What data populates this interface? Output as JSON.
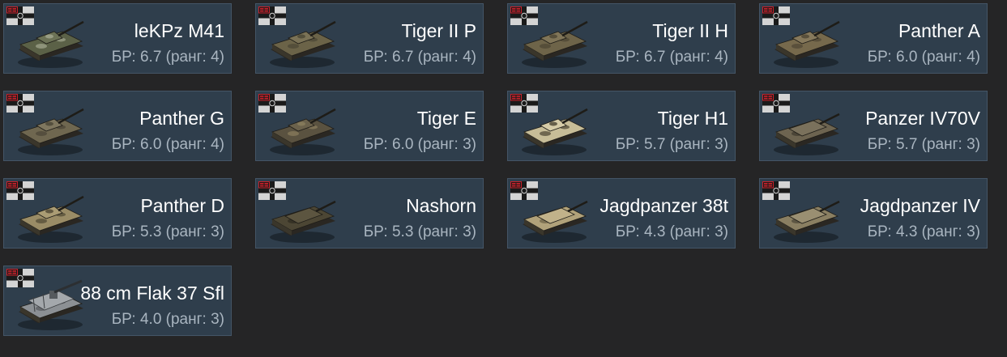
{
  "nation": "germany",
  "flag_icon": "german-war-ensign-icon",
  "vehicles": [
    {
      "name": "leKPz M41",
      "br": "БР: 6.7 (ранг: 4)",
      "icon": "tank-icon",
      "hull": "#5b6147",
      "turret": "#6c7256",
      "camo": "#a4a890"
    },
    {
      "name": "Tiger II P",
      "br": "БР: 6.7 (ранг: 4)",
      "icon": "tank-icon",
      "hull": "#6b6348",
      "turret": "#7a7256",
      "camo": "#4a4634"
    },
    {
      "name": "Tiger II H",
      "br": "БР: 6.7 (ранг: 4)",
      "icon": "tank-icon",
      "hull": "#6e6449",
      "turret": "#807558",
      "camo": "#4b4533"
    },
    {
      "name": "Panther A",
      "br": "БР: 6.0 (ранг: 4)",
      "icon": "tank-icon",
      "hull": "#76694c",
      "turret": "#86795c",
      "camo": "#4e4634"
    },
    {
      "name": "Panther G",
      "br": "БР: 6.0 (ранг: 4)",
      "icon": "tank-icon",
      "hull": "#6f6750",
      "turret": "#7f775f",
      "camo": "#4a4536"
    },
    {
      "name": "Tiger E",
      "br": "БР: 6.0 (ранг: 3)",
      "icon": "tank-icon",
      "hull": "#5a5240",
      "turret": "#6b624c",
      "camo": "#8b7f5e"
    },
    {
      "name": "Tiger H1",
      "br": "БР: 5.7 (ранг: 3)",
      "icon": "tank-icon",
      "hull": "#c7bd98",
      "turret": "#d6cca8",
      "camo": "#4a4332"
    },
    {
      "name": "Panzer IV70V",
      "br": "БР: 5.7 (ранг: 3)",
      "icon": "tank-destroyer-icon",
      "hull": "#6d6450",
      "turret": "#7a715c",
      "camo": "#3d382c"
    },
    {
      "name": "Panther D",
      "br": "БР: 5.3 (ранг: 3)",
      "icon": "tank-icon",
      "hull": "#9a8c66",
      "turret": "#aa9c74",
      "camo": "#4f4733"
    },
    {
      "name": "Nashorn",
      "br": "БР: 5.3 (ранг: 3)",
      "icon": "tank-destroyer-icon",
      "hull": "#4c4634",
      "turret": "#5c5540",
      "camo": "#2e2a20"
    },
    {
      "name": "Jagdpanzer 38t",
      "br": "БР: 4.3 (ранг: 3)",
      "icon": "tank-destroyer-icon",
      "hull": "#b1a27a",
      "turret": "#c1b28a",
      "camo": "#6a5f45"
    },
    {
      "name": "Jagdpanzer IV",
      "br": "БР: 4.3 (ранг: 3)",
      "icon": "tank-destroyer-icon",
      "hull": "#8a7f62",
      "turret": "#9a8f72",
      "camo": "#4a4536"
    },
    {
      "name": "88 cm Flak 37 Sfl",
      "br": "БР: 4.0 (ранг: 3)",
      "icon": "flak-vehicle-icon",
      "hull": "#8c9094",
      "turret": "#a4a8ac",
      "camo": "#55595d"
    }
  ]
}
